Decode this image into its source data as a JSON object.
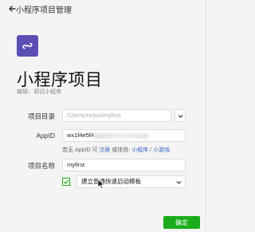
{
  "header": {
    "title": "小程序项目管理"
  },
  "page": {
    "title": "小程序项目",
    "subtitle": "编辑、调试小程序"
  },
  "form": {
    "directory": {
      "label": "项目目录",
      "value": "/Users/xiejun/myfirst"
    },
    "appid": {
      "label": "AppID",
      "value_visible": "wx1f4e5f4",
      "hint_prefix": "若无 AppID 可",
      "hint_register": "注册",
      "hint_middle": "或体验:",
      "hint_miniprogram": "小程序",
      "hint_sep": "/",
      "hint_minigame": "小游戏"
    },
    "name": {
      "label": "项目名称",
      "value": "myfirst"
    },
    "template": {
      "checked": true,
      "value": "建立普通快速启动模板"
    }
  },
  "actions": {
    "confirm_label": "确定"
  },
  "colors": {
    "accent": "#1aad19",
    "brand": "#5b4fb5",
    "link": "#3a63c4"
  },
  "icons": [
    "back-arrow-icon",
    "miniprogram-logo-icon",
    "chevron-down-icon",
    "checkmark-icon",
    "mouse-cursor-icon"
  ]
}
